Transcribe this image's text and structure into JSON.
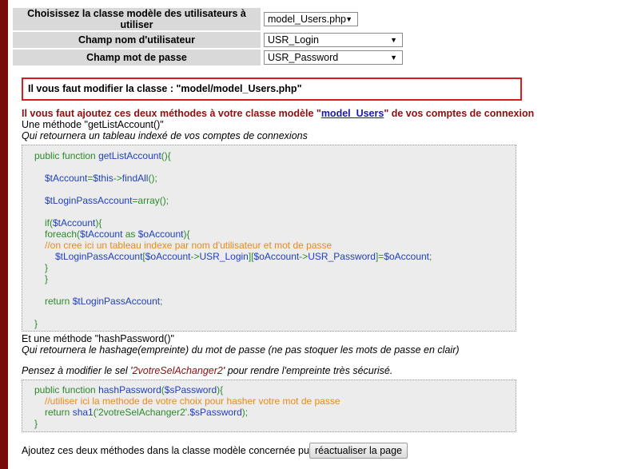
{
  "config": {
    "rows": [
      {
        "label": "Choisissez la classe modèle des utilisateurs à utiliser",
        "value": "model_Users.php"
      },
      {
        "label": "Champ nom d'utilisateur",
        "value": "USR_Login"
      },
      {
        "label": "Champ mot de passe",
        "value": "USR_Password"
      }
    ]
  },
  "alert": {
    "text": "Il vous faut modifier la classe : \"model/model_Users.php\""
  },
  "instructions": {
    "warn_before": "Il vous faut ajoutez ces deux méthodes à votre classe modèle \"",
    "warn_link": "model_Users",
    "warn_after": "\" de vos comptes de connexion",
    "method1_title": "Une méthode \"getListAccount()\"",
    "method1_desc": "Qui retournera un tableau indexé de vos comptes de connexions",
    "method2_title": "Et une méthode \"hashPassword()\"",
    "method2_desc": "Qui retournera le hashage(empreinte) du mot de passe (ne pas stoquer les mots de passe en clair)",
    "salt_before": "Pensez à modifier le sel '",
    "salt_value": "2votreSelAchanger2",
    "salt_after": "' pour rendre l'empreinte très sécurisé.",
    "footer": "Ajoutez ces deux méthodes dans la classe modèle concernée puis",
    "refresh_button": "réactualiser la page"
  },
  "code1": {
    "l1a": "public function ",
    "l1b": "getListAccount",
    "l1c": "(){",
    "l2a": "$tAccount",
    "l2b": "=",
    "l2c": "$this",
    "l2d": "->",
    "l2e": "findAll",
    "l2f": "();",
    "l3a": "$tLoginPassAccount",
    "l3b": "=",
    "l3c": "array",
    "l3d": "();",
    "l4a": "if(",
    "l4b": "$tAccount",
    "l4c": "){",
    "l5a": "foreach(",
    "l5b": "$tAccount",
    "l5c": " as ",
    "l5d": "$oAccount",
    "l5e": "){",
    "l6": "//on cree ici un tableau indexe par nom d'utilisateur et mot de passe",
    "l7a": "$tLoginPassAccount",
    "l7b": "[",
    "l7c": "$oAccount",
    "l7d": "->",
    "l7e": "USR_Login",
    "l7f": "][",
    "l7g": "$oAccount",
    "l7h": "->",
    "l7i": "USR_Password",
    "l7j": "]=",
    "l7k": "$oAccount",
    "l7l": ";",
    "l8": "}",
    "l9": "}",
    "l10a": "return ",
    "l10b": "$tLoginPassAccount",
    "l10c": ";",
    "l11": "}"
  },
  "code2": {
    "l1a": "public function ",
    "l1b": "hashPassword",
    "l1c": "(",
    "l1d": "$sPassword",
    "l1e": "){",
    "l2": "//utiliser ici la methode de votre choix pour hasher votre mot de passe",
    "l3a": "return ",
    "l3b": "sha1",
    "l3c": "('2votreSelAchanger2'.",
    "l3d": "$sPassword",
    "l3e": ");",
    "l4": "}"
  }
}
